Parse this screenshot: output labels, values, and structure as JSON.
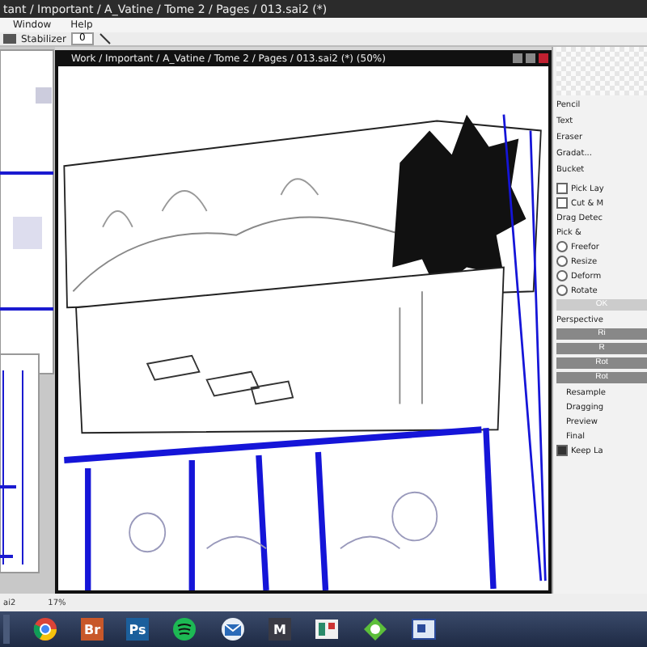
{
  "window": {
    "title": "tant / Important / A_Vatine / Tome 2 / Pages / 013.sai2 (*)"
  },
  "menu": [
    "Window",
    "Help"
  ],
  "toolbar": {
    "stabilizer_label": "Stabilizer",
    "stabilizer_value": "0"
  },
  "document": {
    "title": "Work / Important / A_Vatine / Tome 2 / Pages / 013.sai2 (*) (50%)"
  },
  "tools": [
    "Pencil",
    "Text",
    "Eraser",
    "Gradat...",
    "Bucket"
  ],
  "checks": [
    {
      "label": "Pick Lay",
      "checked": false
    },
    {
      "label": "Cut & M",
      "checked": false
    }
  ],
  "drag_label": "Drag Detec",
  "pick_label": "Pick &",
  "transform_modes": [
    {
      "label": "Freefor",
      "selected": false
    },
    {
      "label": "Resize",
      "selected": false
    },
    {
      "label": "Deform",
      "selected": false
    },
    {
      "label": "Rotate",
      "selected": false
    }
  ],
  "ok_button": "OK",
  "perspective_label": "Perspective",
  "perspective_buttons": [
    "Ri",
    "R",
    "Rot",
    "Rot"
  ],
  "resample_rows": [
    "Resample",
    "Dragging",
    "Preview",
    "Final"
  ],
  "keep_layer": {
    "label": "Keep La",
    "checked": true
  },
  "status": {
    "file": "ai2",
    "zoom": "17%"
  },
  "taskbar": [
    {
      "kind": "chrome"
    },
    {
      "kind": "letter",
      "label": "Br",
      "color": "#c8582a"
    },
    {
      "kind": "letter",
      "label": "Ps",
      "color": "#1b5f9c"
    },
    {
      "kind": "spotify"
    },
    {
      "kind": "mail"
    },
    {
      "kind": "letter",
      "label": "M",
      "color": "#3a3a44"
    },
    {
      "kind": "sai"
    },
    {
      "kind": "green"
    },
    {
      "kind": "window"
    }
  ]
}
